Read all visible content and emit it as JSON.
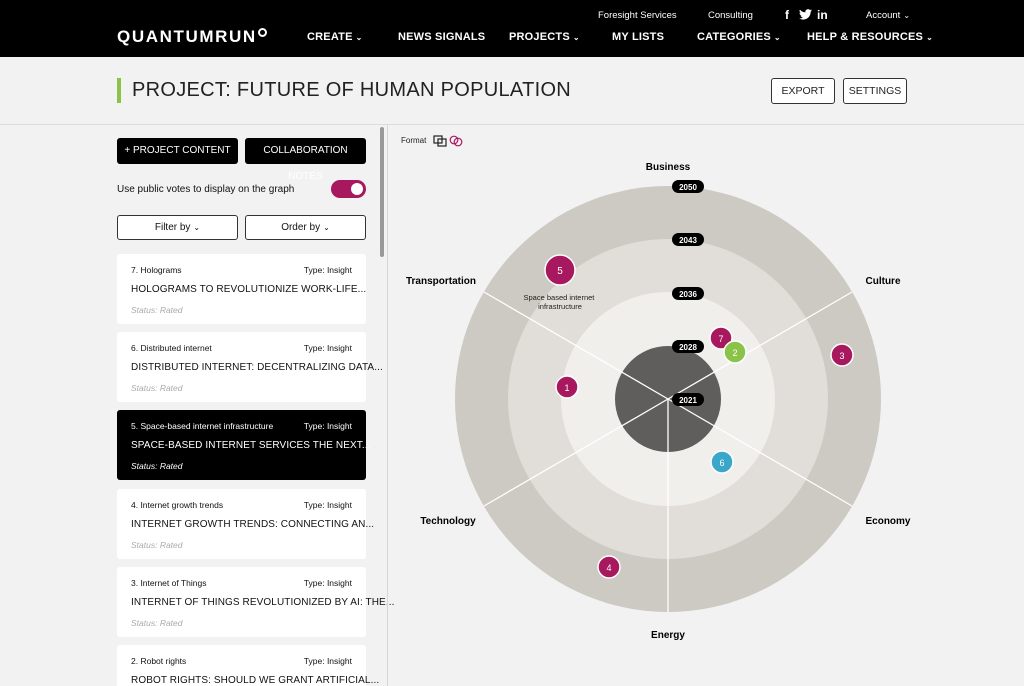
{
  "nav": {
    "logo": "QUANTUMRUN",
    "util": {
      "foresight": "Foresight Services",
      "consulting": "Consulting",
      "account": "Account"
    },
    "social": {
      "facebook": "f",
      "linkedin": "in"
    },
    "items": {
      "create": "CREATE",
      "news": "NEWS SIGNALS",
      "projects": "PROJECTS",
      "lists": "MY LISTS",
      "categories": "CATEGORIES",
      "help": "HELP & RESOURCES"
    }
  },
  "header": {
    "title": "PROJECT: FUTURE OF HUMAN POPULATION",
    "export_label": "EXPORT",
    "settings_label": "SETTINGS"
  },
  "panel": {
    "project_content_label": "+ PROJECT CONTENT",
    "collab_label": "COLLABORATION NOTES",
    "public_votes_label": "Use public votes to display on the graph",
    "public_votes_on": true,
    "filter_label": "Filter by",
    "order_label": "Order by",
    "cards": [
      {
        "category": "7. Holograms",
        "type": "Type: Insight",
        "title": "HOLOGRAMS TO REVOLUTIONIZE WORK-LIFE...",
        "status": "Status: Rated"
      },
      {
        "category": "6. Distributed internet",
        "type": "Type: Insight",
        "title": "DISTRIBUTED INTERNET: DECENTRALIZING DATA...",
        "status": "Status: Rated"
      },
      {
        "category": "5. Space-based internet infrastructure",
        "type": "Type: Insight",
        "title": "SPACE-BASED INTERNET SERVICES THE NEXT...",
        "status": "Status: Rated"
      },
      {
        "category": "4. Internet growth trends",
        "type": "Type: Insight",
        "title": "INTERNET GROWTH TRENDS: CONNECTING AN...",
        "status": "Status: Rated"
      },
      {
        "category": "3. Internet of Things",
        "type": "Type: Insight",
        "title": "INTERNET OF THINGS REVOLUTIONIZED BY AI: THE...",
        "status": "Status: Rated"
      },
      {
        "category": "2. Robot rights",
        "type": "Type: Insight",
        "title": "ROBOT RIGHTS: SHOULD WE GRANT ARTIFICIAL..."
      }
    ]
  },
  "radar": {
    "format_label": "Format",
    "sectors": {
      "business": "Business",
      "culture": "Culture",
      "economy": "Economy",
      "energy": "Energy",
      "technology": "Technology",
      "transportation": "Transportation"
    },
    "years": [
      "2050",
      "2043",
      "2036",
      "2028",
      "2021"
    ],
    "hover_label": "Space based internet infrastructure",
    "points": [
      {
        "label": "1",
        "color": "#a8185f"
      },
      {
        "label": "2",
        "color": "#8bc34a"
      },
      {
        "label": "3",
        "color": "#a8185f"
      },
      {
        "label": "4",
        "color": "#a8185f"
      },
      {
        "label": "5",
        "color": "#a8185f"
      },
      {
        "label": "6",
        "color": "#3aa6c9"
      },
      {
        "label": "7",
        "color": "#a8185f"
      }
    ]
  },
  "colors": {
    "accent_green": "#8bc34a",
    "magenta": "#a8185f",
    "blue": "#3aa6c9"
  }
}
